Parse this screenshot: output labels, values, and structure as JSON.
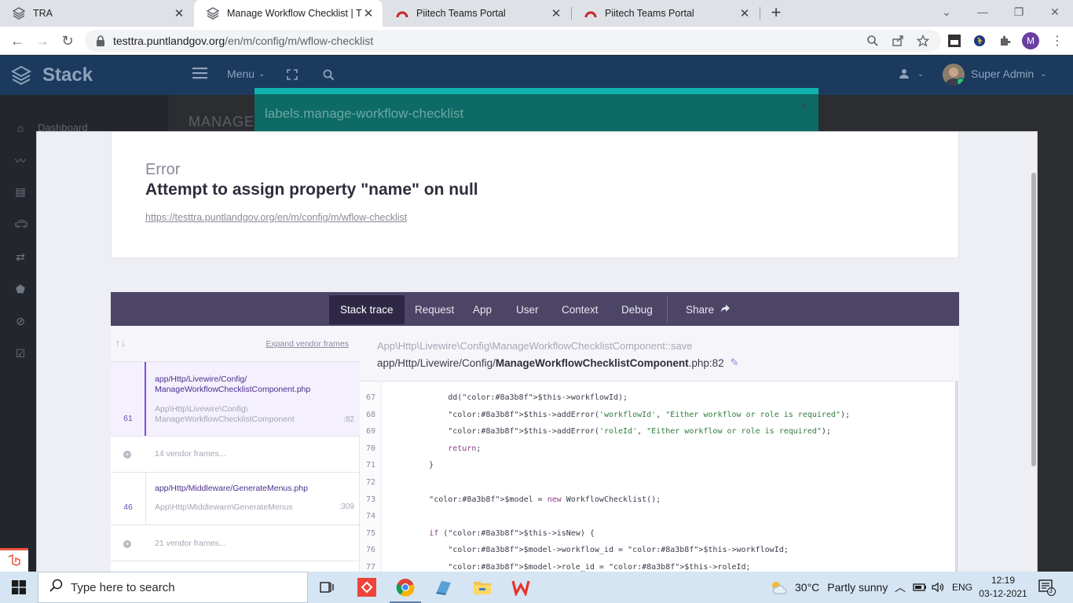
{
  "browser": {
    "tabs": [
      {
        "label": "TRA",
        "active": false
      },
      {
        "label": "Manage Workflow Checklist | TRA",
        "active": true
      },
      {
        "label": "Piitech Teams Portal",
        "active": false
      },
      {
        "label": "Piitech Teams Portal",
        "active": false
      }
    ],
    "url_host": "testtra.puntlandgov.org",
    "url_path": "/en/m/config/m/wflow-checklist",
    "profile_initial": "M"
  },
  "app": {
    "brand": "Stack",
    "menu_label": "Menu",
    "user_name": "Super Admin",
    "sidebar_dashboard": "Dashboard",
    "page_title_bg": "MANAGE",
    "modal_title": "labels.manage-workflow-checklist"
  },
  "error": {
    "kicker": "Error",
    "message": "Attempt to assign property \"name\" on null",
    "url": "https://testtra.puntlandgov.org/en/m/config/m/wflow-checklist",
    "tabs": [
      "Stack trace",
      "Request",
      "App",
      "User",
      "Context",
      "Debug",
      "Share"
    ],
    "expand_vendor": "Expand vendor frames",
    "frames": [
      {
        "number": "61",
        "file": "app/Http/Livewire/Config/\nManageWorkflowChecklistComponent.php",
        "cls": "App\\Http\\Livewire\\Config\\\nManageWorkflowChecklistComponent",
        "line": ":82"
      },
      {
        "number": "46",
        "file": "app/Http/Middleware/GenerateMenus.php",
        "cls": "App\\Http\\Middleware\\GenerateMenus",
        "line": ":309"
      }
    ],
    "vendor_1": "14 vendor frames...",
    "vendor_2": "21 vendor frames...",
    "code_ns": "App\\Http\\Livewire\\Config\\ManageWorkflowChecklistComponent::save",
    "code_file_prefix": "app/Http/Livewire/Config/",
    "code_file_name": "ManageWorkflowChecklistComponent",
    "code_file_suffix": ".php:82",
    "code_lines": [
      {
        "n": "67",
        "t": "            dd($this->workflowId);"
      },
      {
        "n": "68",
        "t": "            $this->addError('workflowId', \"Either workflow or role is required\");"
      },
      {
        "n": "69",
        "t": "            $this->addError('roleId', \"Either workflow or role is required\");"
      },
      {
        "n": "70",
        "t": "            return;"
      },
      {
        "n": "71",
        "t": "        }"
      },
      {
        "n": "72",
        "t": ""
      },
      {
        "n": "73",
        "t": "        $model = new WorkflowChecklist();"
      },
      {
        "n": "74",
        "t": ""
      },
      {
        "n": "75",
        "t": "        if ($this->isNew) {"
      },
      {
        "n": "76",
        "t": "            $model->workflow_id = $this->workflowId;"
      },
      {
        "n": "77",
        "t": "            $model->role_id = $this->roleId;"
      }
    ]
  },
  "taskbar": {
    "search_placeholder": "Type here to search",
    "temperature": "30°C",
    "weather": "Partly sunny",
    "lang": "ENG",
    "time": "12:19",
    "date": "03-12-2021",
    "notif_count": "3"
  },
  "colors": {
    "app_header": "#1b3a5e",
    "ignition_tabbar": "#4d4566",
    "accent_purple": "#7c4ddd",
    "modal_teal": "#0fb3ab"
  }
}
